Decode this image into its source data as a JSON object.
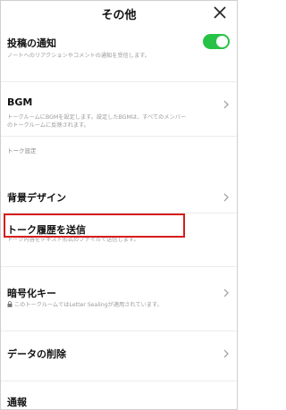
{
  "header": {
    "title": "その他",
    "close_icon": "close-icon"
  },
  "rows": {
    "post_notify": {
      "title": "投稿の通知",
      "desc": "ノートへのリアクションやコメントの通知を受信します。",
      "toggle_on": true
    },
    "bgm": {
      "title": "BGM",
      "desc_line1": "トークルームにBGMを設定します。設定したBGMは、すべてのメンバー",
      "desc_line2": "のトークルームに反映されます。"
    },
    "section_talk": {
      "label": "トーク設定"
    },
    "bg_design": {
      "title": "背景デザイン"
    },
    "send_history": {
      "title": "トーク履歴を送信",
      "desc": "トーク内容をテキスト形式のファイルで送信します。"
    },
    "encryption": {
      "title": "暗号化キー",
      "desc": "このトークルームではLetter Sealingが適用されています。"
    },
    "delete_data": {
      "title": "データの削除"
    },
    "report": {
      "title": "通報"
    }
  },
  "colors": {
    "toggle": "#28c346",
    "highlight": "#d81b1b"
  }
}
